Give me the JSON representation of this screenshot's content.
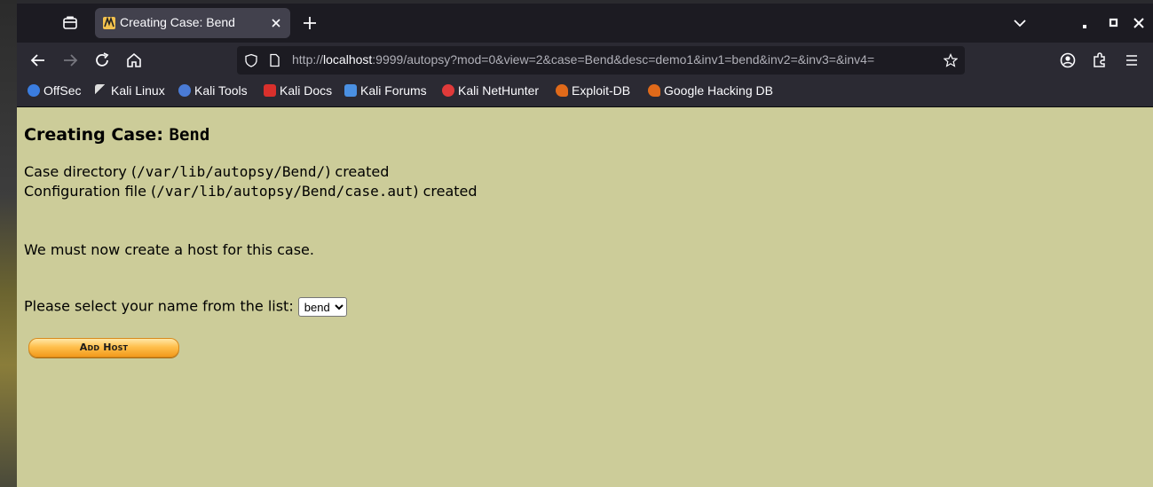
{
  "browser": {
    "tab_title": "Creating Case: Bend",
    "url_prefix": "http://",
    "url_host": "localhost",
    "url_rest": ":9999/autopsy?mod=0&view=2&case=Bend&desc=demo1&inv1=bend&inv2=&inv3=&inv4=",
    "bookmarks": [
      {
        "label": "OffSec",
        "icon": "offsec-icon",
        "color": "#3b7de0"
      },
      {
        "label": "Kali Linux",
        "icon": "kali-dragon-icon",
        "color": "#cccccc"
      },
      {
        "label": "Kali Tools",
        "icon": "kali-tools-icon",
        "color": "#4a7bd6"
      },
      {
        "label": "Kali Docs",
        "icon": "kali-docs-icon",
        "color": "#d9302c"
      },
      {
        "label": "Kali Forums",
        "icon": "kali-forums-icon",
        "color": "#4a90e2"
      },
      {
        "label": "Kali NetHunter",
        "icon": "nethunter-icon",
        "color": "#e03a3a"
      },
      {
        "label": "Exploit-DB",
        "icon": "exploitdb-icon",
        "color": "#e06a1a"
      },
      {
        "label": "Google Hacking DB",
        "icon": "ghdb-icon",
        "color": "#e06a1a"
      }
    ]
  },
  "page": {
    "heading_prefix": "Creating Case: ",
    "heading_case": "Bend",
    "case_dir_pre": "Case directory (",
    "case_dir_path": "/var/lib/autopsy/Bend/",
    "case_dir_post": ") created",
    "config_pre": "Configuration file (",
    "config_path": "/var/lib/autopsy/Bend/case.aut",
    "config_post": ") created",
    "host_msg": "We must now create a host for this case.",
    "select_label": "Please select your name from the list: ",
    "select_value": "bend",
    "add_host_label": "Add Host"
  }
}
